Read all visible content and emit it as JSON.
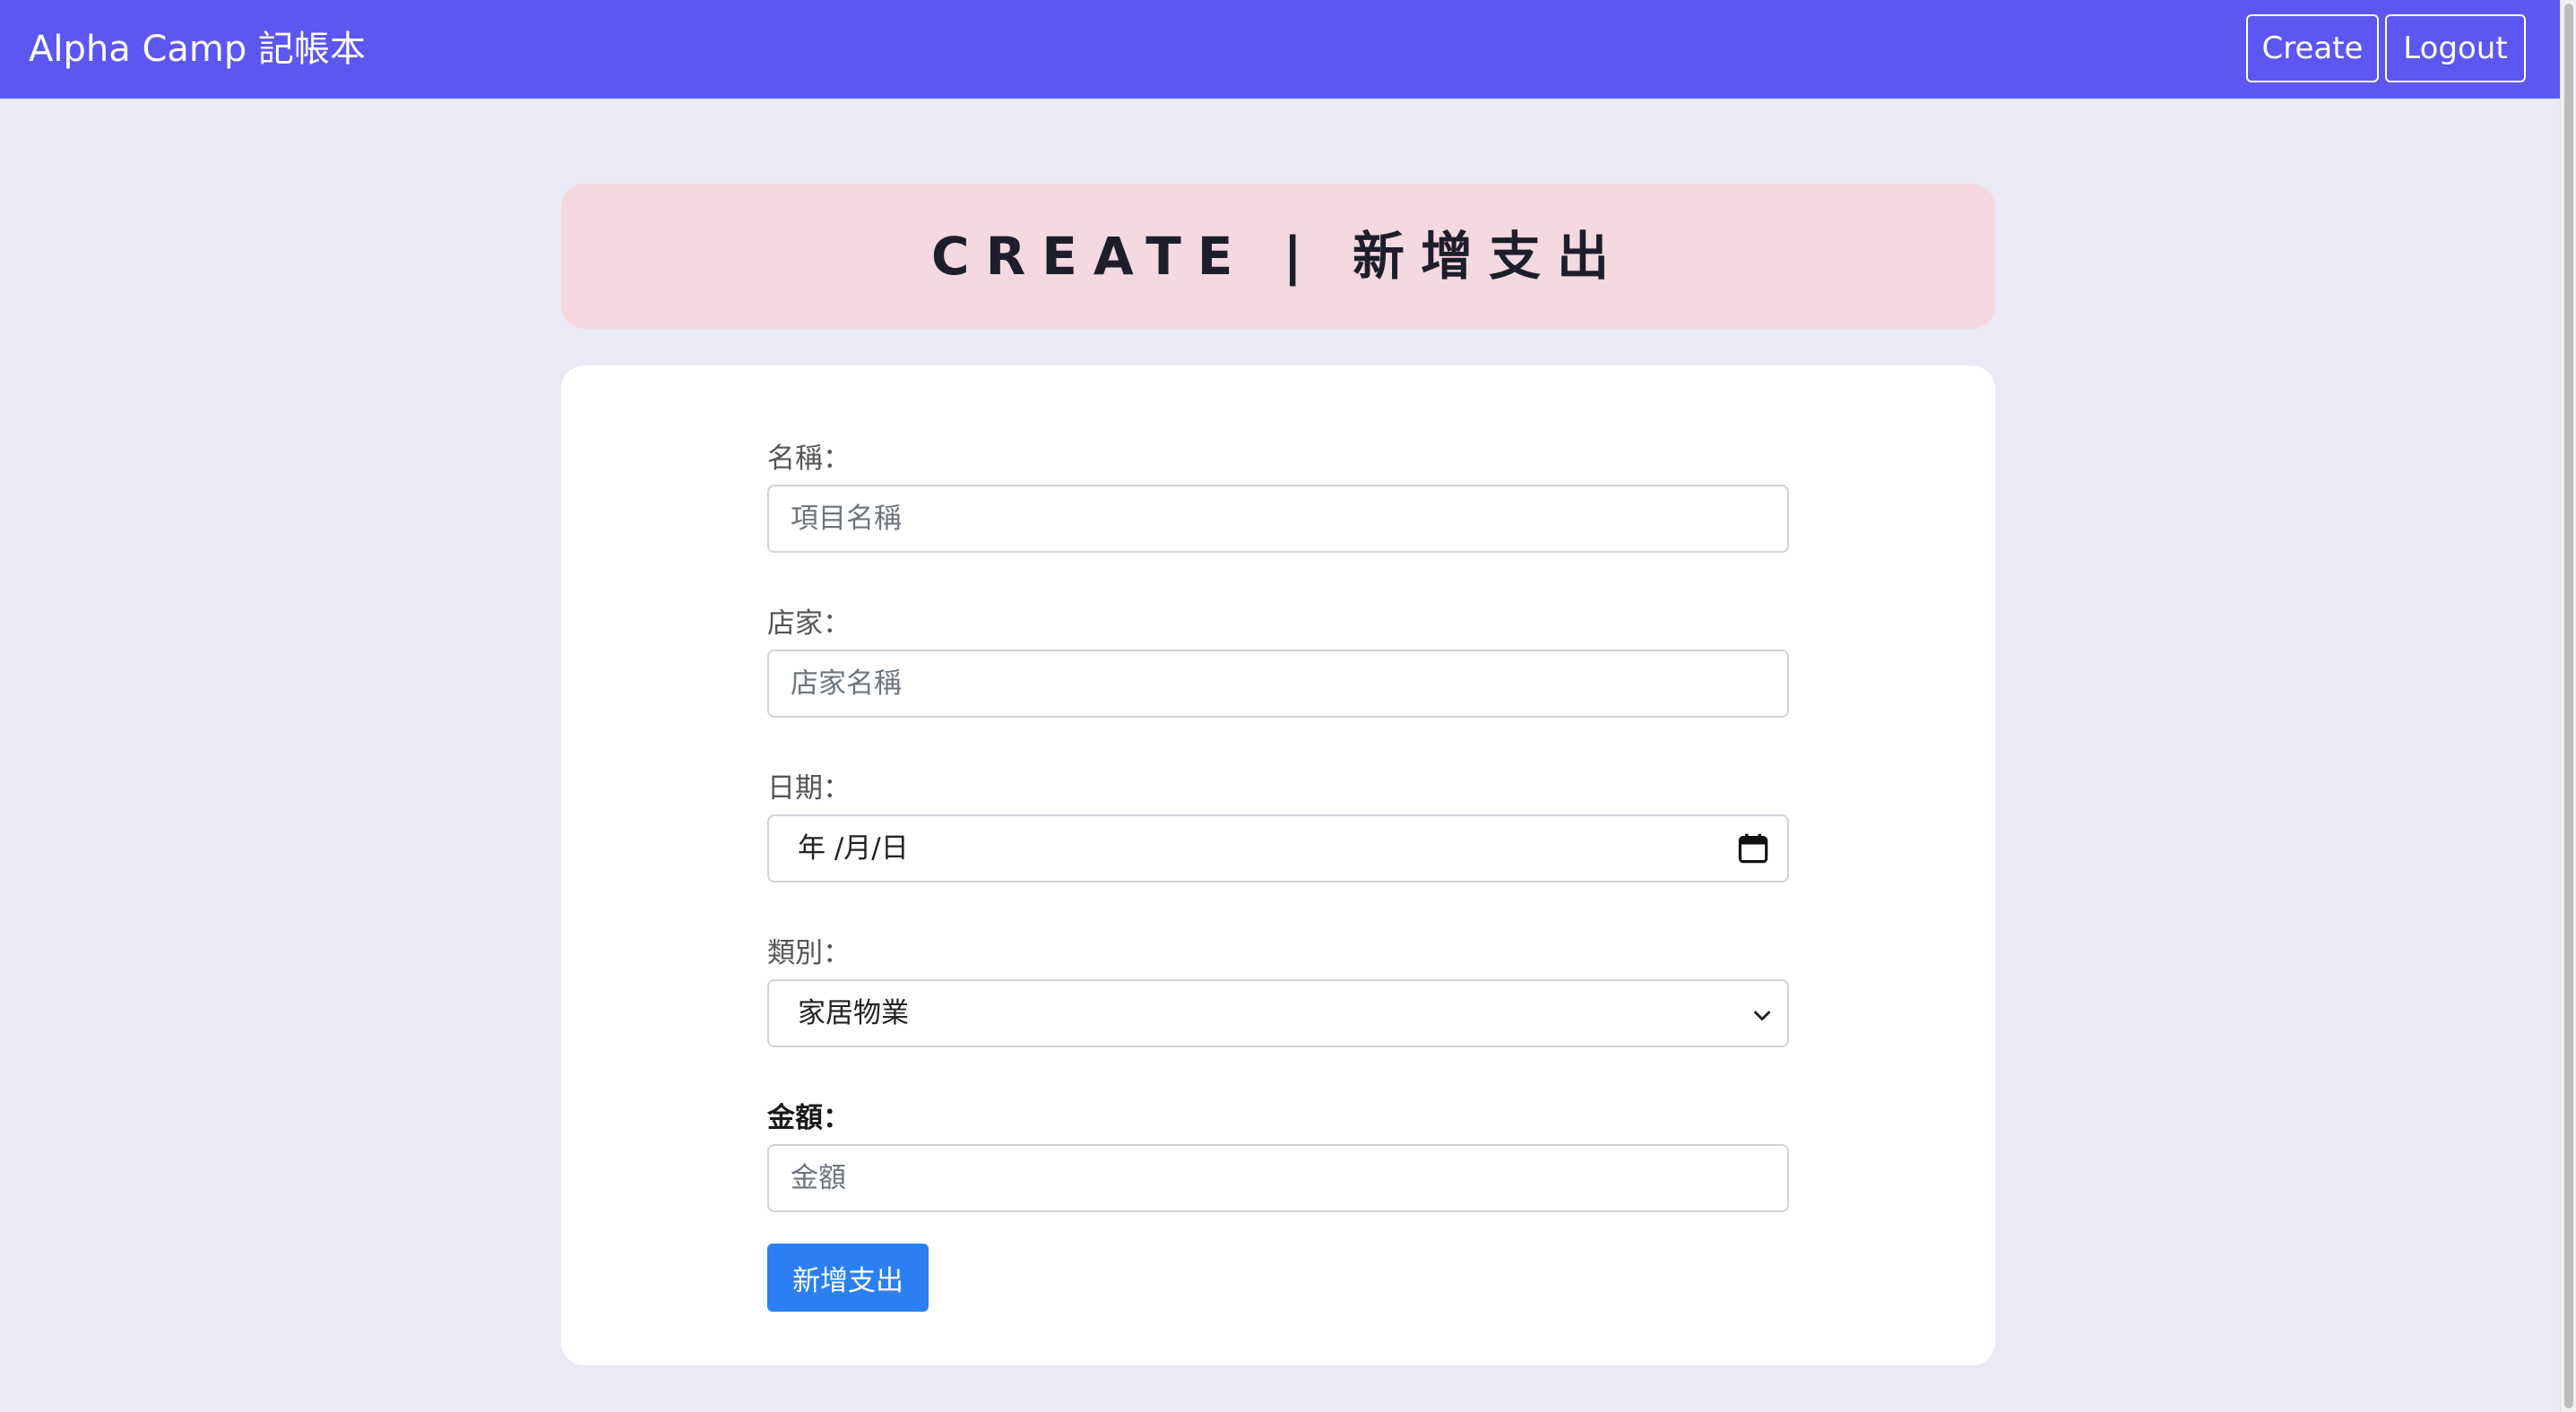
{
  "navbar": {
    "brand": "Alpha Camp 記帳本",
    "create_label": "Create",
    "logout_label": "Logout"
  },
  "title": "CREATE | 新增支出",
  "form": {
    "name": {
      "label": "名稱：",
      "placeholder": "項目名稱",
      "value": ""
    },
    "store": {
      "label": "店家：",
      "placeholder": "店家名稱",
      "value": ""
    },
    "date": {
      "label": "日期：",
      "display": "年 /月/日"
    },
    "category": {
      "label": "類別：",
      "selected": "家居物業"
    },
    "amount": {
      "label": "金額：",
      "placeholder": "金額",
      "value": ""
    },
    "submit_label": "新增支出"
  },
  "icons": {
    "date_picker": "calendar-icon",
    "select_arrow": "chevron-down-icon"
  },
  "colors": {
    "navbar": "#5b57f0",
    "background": "#eae9f7",
    "banner": "#f5d9e0",
    "submit": "#2b7ff2"
  }
}
